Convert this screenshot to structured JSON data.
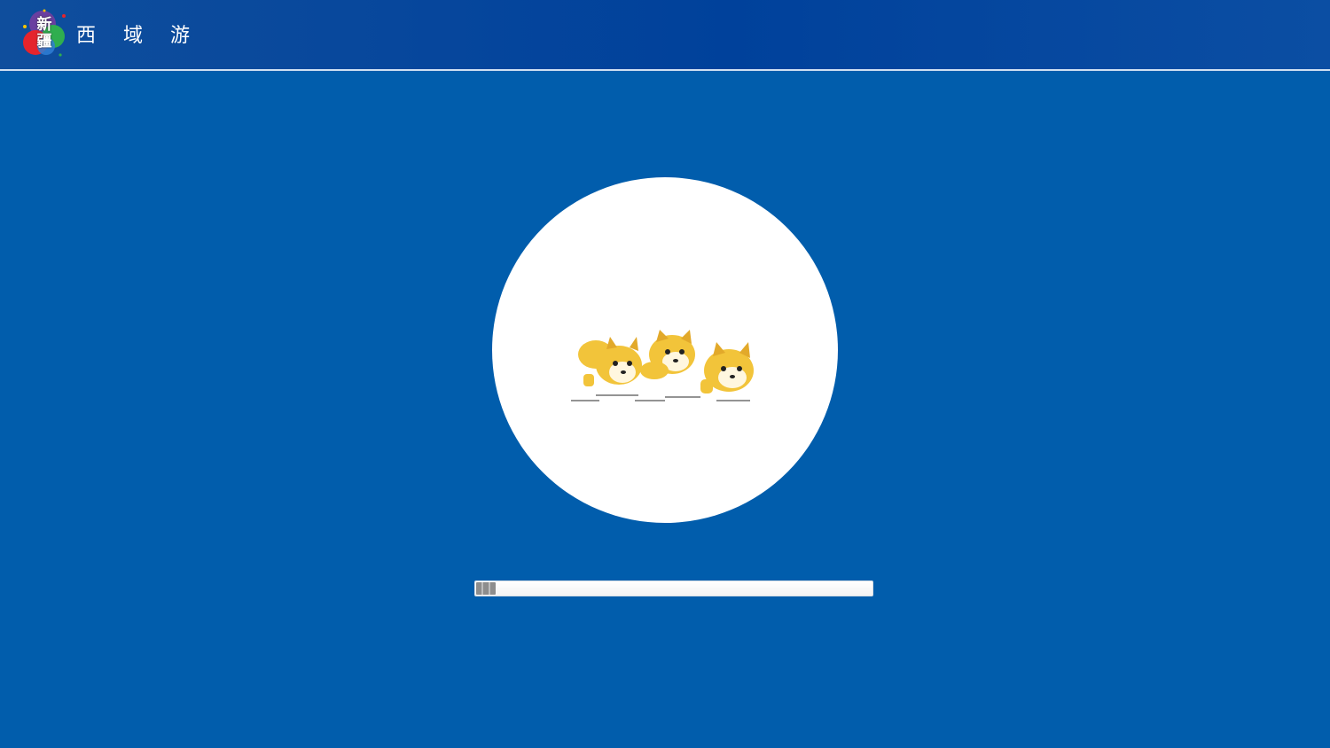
{
  "header": {
    "logo_top_char": "新",
    "logo_bottom_char": "疆",
    "title": "西 域 游"
  },
  "loader": {
    "animation_icon": "running-doge-icon",
    "progress": 0.05
  },
  "colors": {
    "background": "#015dac",
    "header": "#00419b",
    "circle": "#ffffff",
    "dog_fur": "#f2c43a"
  }
}
